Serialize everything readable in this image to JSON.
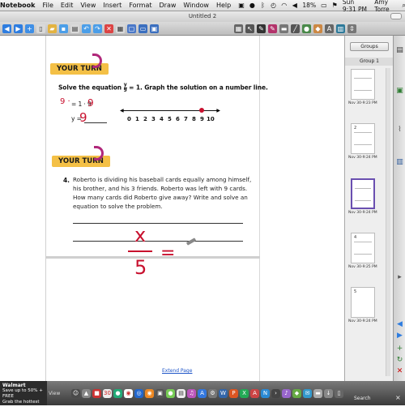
{
  "menubar": {
    "app_name": "Notebook",
    "items": [
      "File",
      "Edit",
      "View",
      "Insert",
      "Format",
      "Draw",
      "Window",
      "Help"
    ],
    "battery": "18%",
    "clock": "Sun 9:31 PM",
    "user": "Amy Torre"
  },
  "window": {
    "title": "Untitled 2"
  },
  "toolbar": {
    "icons": [
      "back-icon",
      "forward-icon",
      "add-page-icon",
      "delete-page-icon",
      "open-file-icon",
      "save-icon",
      "paste-icon",
      "undo-icon",
      "redo-icon",
      "delete-icon",
      "screen-shade-icon",
      "full-screen-icon",
      "display-icon",
      "capture-icon",
      "table-icon",
      "select-icon",
      "pen-icon",
      "creative-pen-icon",
      "eraser-icon",
      "line-icon",
      "shapes-icon",
      "fill-icon",
      "text-icon",
      "properties-icon",
      "move-toolbar-icon"
    ]
  },
  "page": {
    "turn1": {
      "banner": "YOUR TURN",
      "prompt": "Solve the equation",
      "fraction_num": "y",
      "fraction_den": "9",
      "prompt_tail": "= 1. Graph the solution on a number line.",
      "step1": "9 ·",
      "step1_tail": "= 1 · 9",
      "step2": "y =",
      "number_labels": [
        "0",
        "1",
        "2",
        "3",
        "4",
        "5",
        "6",
        "7",
        "8",
        "9",
        "10"
      ],
      "solution_point": 9
    },
    "turn2": {
      "banner": "YOUR TURN",
      "number": "4.",
      "text": "Roberto is dividing his baseball cards equally among himself, his brother, and his 3 friends. Roberto was left with 9 cards. How many cards did Roberto give away? Write and solve an equation to solve the problem."
    },
    "ink": {
      "step1_left": "9 ·",
      "step1_right": "9",
      "answer": "9",
      "numerator": "x",
      "denominator": "5",
      "equals": "="
    },
    "extend_link": "Extend Page"
  },
  "sidepanel": {
    "groups_button": "Groups",
    "group_label": "Group 1",
    "thumbnails": [
      {
        "time": "Nov 30-9:23 PM",
        "mark": "",
        "selected": false
      },
      {
        "time": "Nov 30-9:24 PM",
        "mark": "2",
        "selected": false
      },
      {
        "time": "Nov 30-9:24 PM",
        "mark": "",
        "selected": true
      },
      {
        "time": "Nov 30-9:25 PM",
        "mark": "4",
        "selected": false
      },
      {
        "time": "Nov 30-9:24 PM",
        "mark": "5",
        "selected": false
      }
    ]
  },
  "tabs": [
    "page-sorter-icon",
    "gallery-icon",
    "attachments-icon",
    "properties-icon"
  ],
  "dock": {
    "notification_title": "Walmart",
    "notification_line1": "Save up to 50% + FREE",
    "notification_line2": "Grab the hottest items",
    "view_label": "View",
    "search_label": "Search",
    "close": "×"
  }
}
